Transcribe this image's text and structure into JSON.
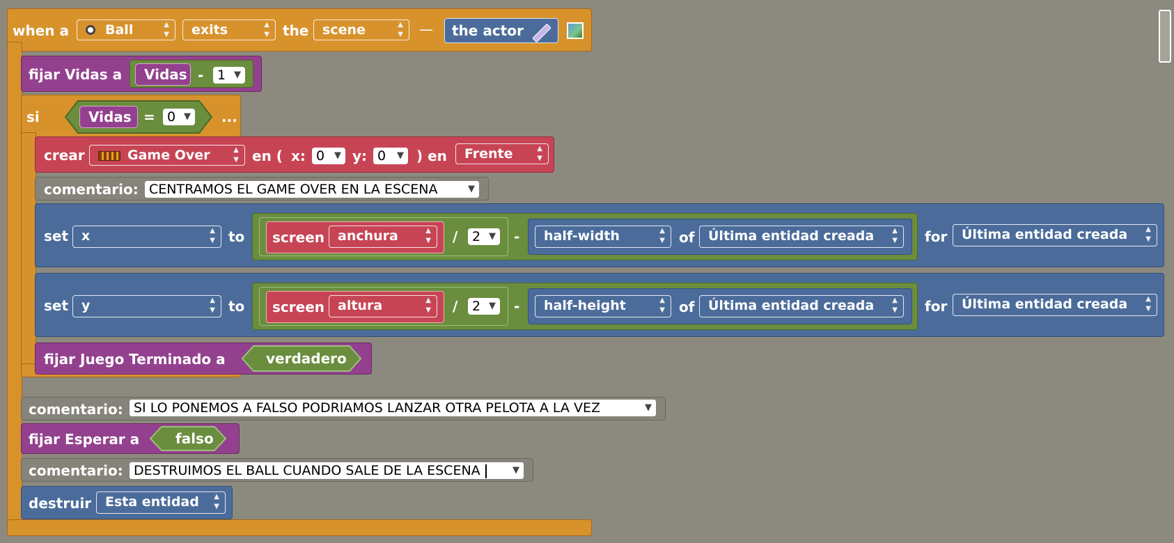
{
  "event": {
    "when": "when a",
    "actor_type": "Ball",
    "event_type": "exits",
    "the": "the",
    "region": "scene",
    "dash": "—",
    "actor": "the actor"
  },
  "set_lives": {
    "label": "fijar Vidas a",
    "var": "Vidas",
    "op": "-",
    "value": "1"
  },
  "if_block": {
    "label": "si",
    "var": "Vidas",
    "op": "=",
    "value": "0",
    "more": "..."
  },
  "create": {
    "label": "crear",
    "actor": "Game Over",
    "en": "en (",
    "x_label": "x:",
    "x": "0",
    "y_label": "y:",
    "y": "0",
    "close": ") en",
    "layer": "Frente"
  },
  "comment1": {
    "label": "comentario:",
    "text": "CENTRAMOS EL GAME OVER EN LA ESCENA"
  },
  "set_x": {
    "set": "set",
    "prop": "x",
    "to": "to",
    "screen": "screen",
    "dim": "anchura",
    "div": "/",
    "divisor": "2",
    "minus": "-",
    "half": "half-width",
    "of": "of",
    "of_target": "Última entidad creada",
    "for": "for",
    "for_target": "Última entidad creada"
  },
  "set_y": {
    "set": "set",
    "prop": "y",
    "to": "to",
    "screen": "screen",
    "dim": "altura",
    "div": "/",
    "divisor": "2",
    "minus": "-",
    "half": "half-height",
    "of": "of",
    "of_target": "Última entidad creada",
    "for": "for",
    "for_target": "Última entidad creada"
  },
  "set_game_over": {
    "label": "fijar Juego Terminado a",
    "value": "verdadero"
  },
  "comment2": {
    "label": "comentario:",
    "text": "SI LO PONEMOS A FALSO PODRIAMOS LANZAR OTRA PELOTA A LA VEZ"
  },
  "set_wait": {
    "label": "fijar Esperar a",
    "value": "falso"
  },
  "comment3": {
    "label": "comentario:",
    "text": "DESTRUIMOS EL BALL CUANDO SALE DE LA ESCENA"
  },
  "destroy": {
    "label": "destruir",
    "target": "Esta entidad"
  },
  "colors": {
    "orange": "#d8922c",
    "purple": "#93418e",
    "green": "#6a8e3e",
    "red": "#c74455",
    "blue": "#4b6c9b",
    "gray": "#85837a",
    "background": "#8c8a7e"
  }
}
